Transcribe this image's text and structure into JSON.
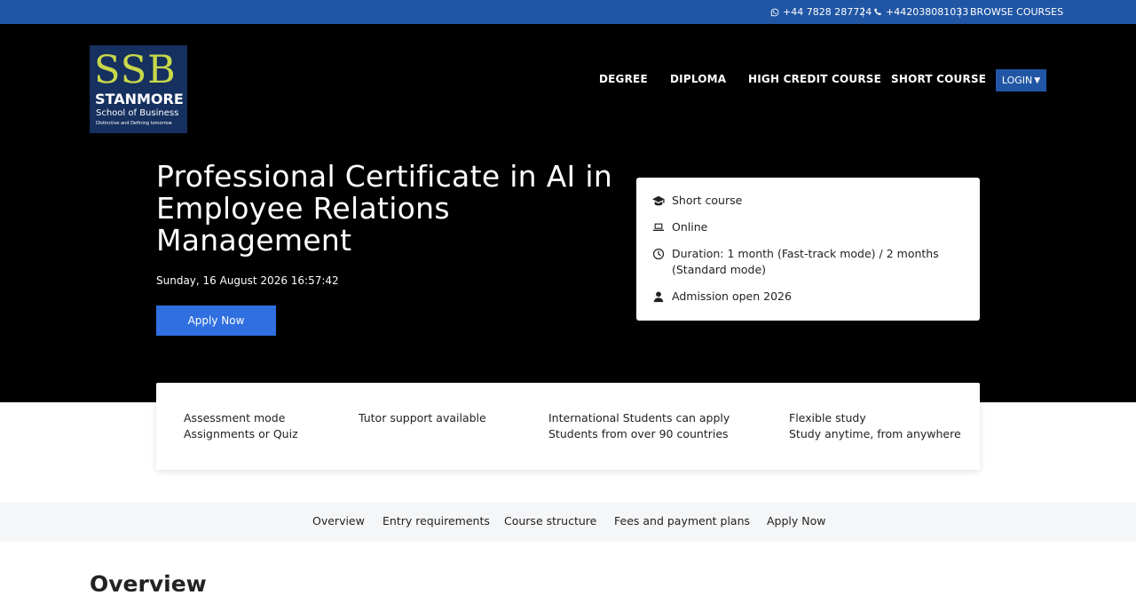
{
  "topbar": {
    "whatsapp": "+44 7828 287724",
    "phone": "+442038081033",
    "browse": "BROWSE COURSES"
  },
  "logo": {
    "ssb": "SSB",
    "name": "STANMORE",
    "sub": "School of Business",
    "tagline": "Distinctive and Defining tomorrow"
  },
  "nav": {
    "items": [
      "DEGREE",
      "DIPLOMA",
      "HIGH CREDIT COURSE",
      "SHORT COURSE"
    ],
    "login": "LOGIN"
  },
  "hero": {
    "title": "Professional Certificate in AI in Employee Relations Management",
    "date": "Sunday, 16 August 2026 16:57:42",
    "apply": "Apply Now"
  },
  "info": {
    "type": "Short course",
    "mode": "Online",
    "duration": "Duration: 1 month (Fast-track mode) / 2 months (Standard mode)",
    "admission": "Admission open 2026"
  },
  "features": [
    {
      "line1": "Assessment mode",
      "line2": "Assignments or Quiz"
    },
    {
      "line1": "Tutor support available",
      "line2": ""
    },
    {
      "line1": "International Students can apply",
      "line2": "Students from over 90 countries"
    },
    {
      "line1": "Flexible study",
      "line2": "Study anytime, from anywhere"
    }
  ],
  "subnav": [
    "Overview",
    "Entry requirements",
    "Course structure",
    "Fees and payment plans",
    "Apply Now"
  ],
  "section": {
    "heading": "Overview"
  },
  "colors": {
    "topbar": "#2156a5",
    "hero_bg": "#000000",
    "apply_button": "#2f6fe0",
    "logo_bg": "#16305f",
    "logo_accent": "#c8d94a"
  }
}
